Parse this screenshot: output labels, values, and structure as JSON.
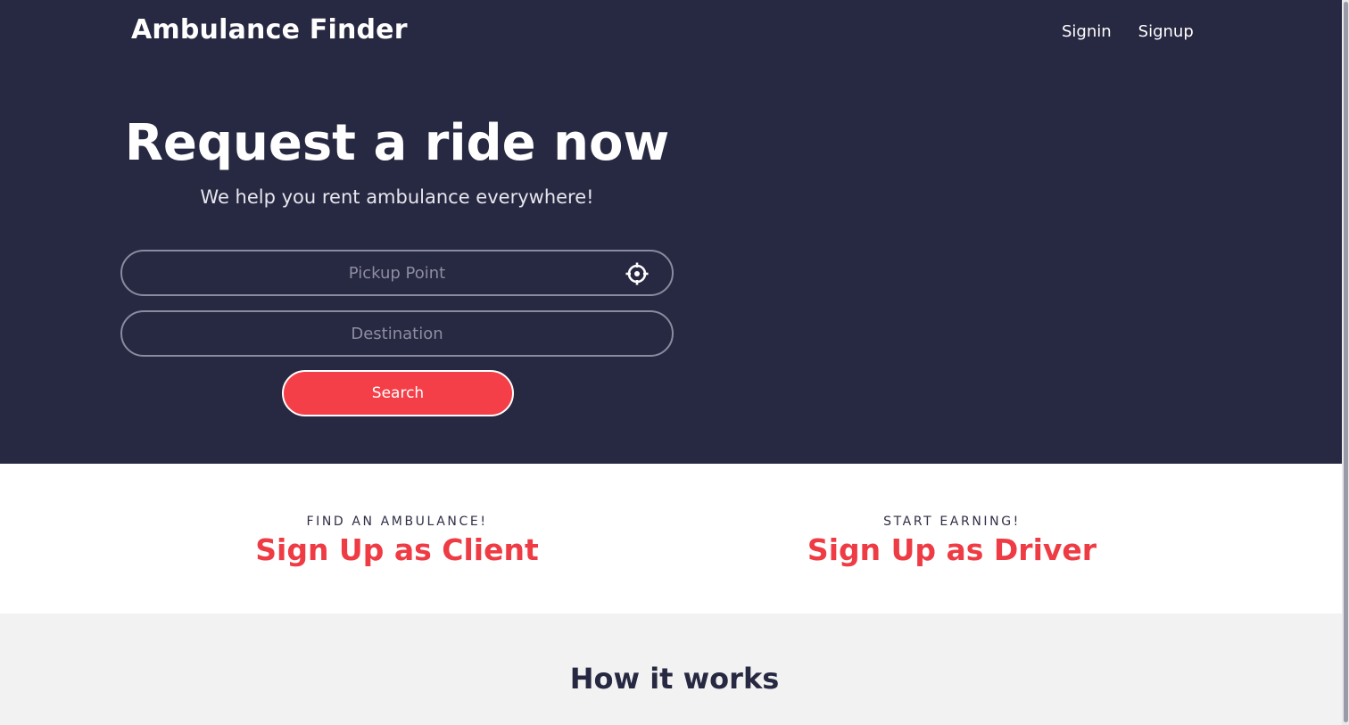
{
  "header": {
    "brand": "Ambulance Finder",
    "nav": [
      {
        "label": "Signin"
      },
      {
        "label": "Signup"
      }
    ]
  },
  "hero": {
    "title": "Request a ride now",
    "subtitle": "We help you rent ambulance everywhere!",
    "pickup": {
      "placeholder": "Pickup Point",
      "value": "",
      "icon": "crosshair-locate-icon"
    },
    "destination": {
      "placeholder": "Destination",
      "value": ""
    },
    "search_label": "Search"
  },
  "signup": {
    "client": {
      "kicker": "FIND AN AMBULANCE!",
      "link": "Sign Up as Client"
    },
    "driver": {
      "kicker": "START EARNING!",
      "link": "Sign Up as Driver"
    }
  },
  "how_it_works": {
    "title": "How it works"
  },
  "colors": {
    "hero_bg": "#272841",
    "accent": "#f43f48",
    "link_red": "#ee3b44",
    "light_bg": "#f2f2f2"
  }
}
